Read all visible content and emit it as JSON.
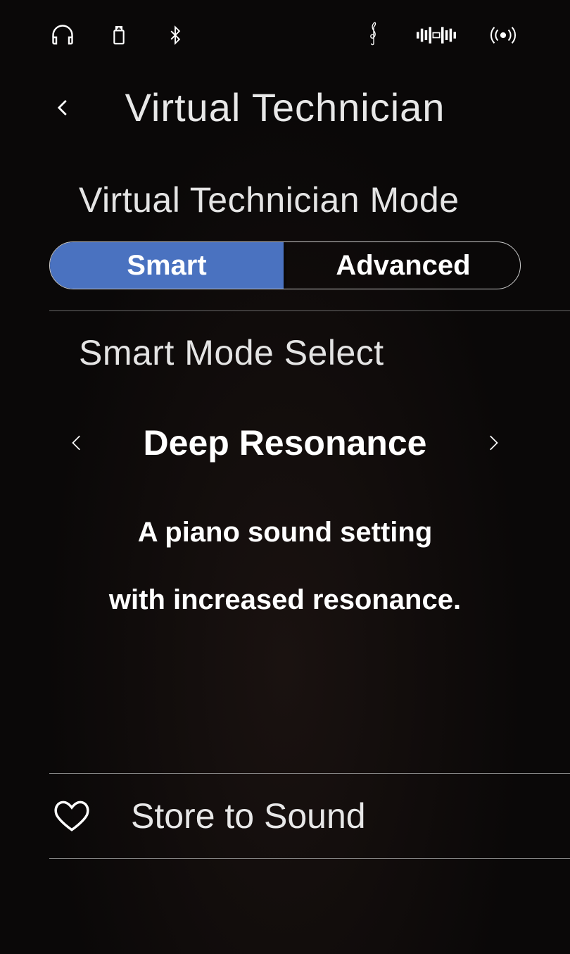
{
  "header": {
    "title": "Virtual Technician"
  },
  "mode": {
    "label": "Virtual Technician Mode",
    "segments": {
      "smart": "Smart",
      "advanced": "Advanced"
    },
    "active": "smart"
  },
  "smartSelect": {
    "label": "Smart Mode Select",
    "value": "Deep Resonance",
    "description_line1": "A piano sound setting",
    "description_line2": "with increased resonance."
  },
  "bottom": {
    "store_label": "Store to Sound"
  }
}
